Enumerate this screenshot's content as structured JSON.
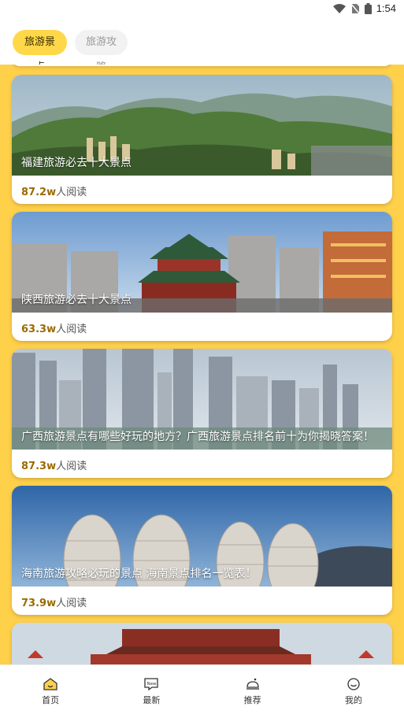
{
  "status_bar": {
    "time": "1:54"
  },
  "tabs": [
    {
      "label": "旅游景点",
      "active": true
    },
    {
      "label": "旅游攻略",
      "active": false
    }
  ],
  "colors": {
    "accent": "#FFD04A",
    "tab_active": "#FFD84A",
    "read_count": "#9b6a00"
  },
  "articles": [
    {
      "title": "福建旅游必去十大景点",
      "reads": "87.2w",
      "reads_suffix": "人阅读"
    },
    {
      "title": "陕西旅游必去十大景点",
      "reads": "63.3w",
      "reads_suffix": "人阅读"
    },
    {
      "title": "广西旅游景点有哪些好玩的地方？广西旅游景点排名前十为你揭晓答案！",
      "reads": "87.3w",
      "reads_suffix": "人阅读"
    },
    {
      "title": "海南旅游攻略必玩的景点 海南景点排名一览表！",
      "reads": "73.9w",
      "reads_suffix": "人阅读"
    }
  ],
  "bottom_nav": [
    {
      "label": "首页",
      "icon": "home-icon",
      "active": true
    },
    {
      "label": "最新",
      "icon": "new-badge-icon",
      "active": false
    },
    {
      "label": "推荐",
      "icon": "recommend-bell-icon",
      "active": false
    },
    {
      "label": "我的",
      "icon": "smile-face-icon",
      "active": false
    }
  ]
}
